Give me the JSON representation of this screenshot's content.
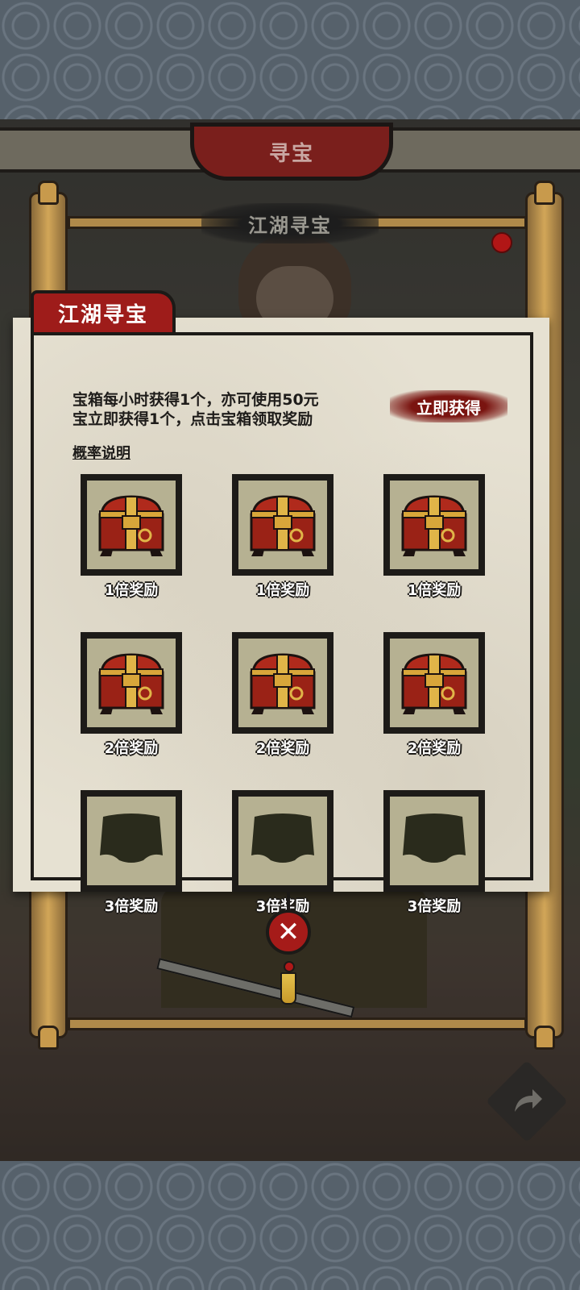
{
  "header": {
    "title": "寻宝"
  },
  "scroll_banner": {
    "title": "江湖寻宝"
  },
  "panel": {
    "tab_title": "江湖寻宝",
    "description_line1": "宝箱每小时获得1个，亦可使用50元",
    "description_line2": "宝立即获得1个，点击宝箱领取奖励",
    "get_now_label": "立即获得",
    "probability_link": "概率说明"
  },
  "chests": [
    {
      "label": "1倍奖励",
      "state": "filled"
    },
    {
      "label": "1倍奖励",
      "state": "filled"
    },
    {
      "label": "1倍奖励",
      "state": "filled"
    },
    {
      "label": "2倍奖励",
      "state": "filled"
    },
    {
      "label": "2倍奖励",
      "state": "filled"
    },
    {
      "label": "2倍奖励",
      "state": "filled"
    },
    {
      "label": "3倍奖励",
      "state": "empty"
    },
    {
      "label": "3倍奖励",
      "state": "empty"
    },
    {
      "label": "3倍奖励",
      "state": "empty"
    }
  ],
  "icons": {
    "close": "close-icon",
    "share": "share-icon",
    "chest": "treasure-chest-icon"
  },
  "colors": {
    "accent_red": "#9e1c1a",
    "paper": "#e6e1d2",
    "slot_bg": "#b6b192"
  }
}
